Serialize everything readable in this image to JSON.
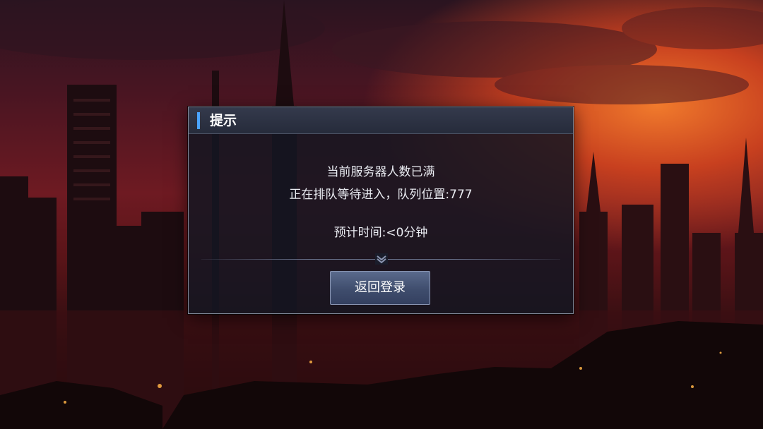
{
  "dialog": {
    "title": "提示",
    "message_line1": "当前服务器人数已满",
    "message_line2": "正在排队等待进入，队列位置:777",
    "message_line3": "预计时间:<0分钟",
    "return_button_label": "返回登录"
  },
  "colors": {
    "accent": "#4aa3ff",
    "sky_glow": "#f07a2c",
    "dialog_background": "#14162299"
  },
  "icons": {
    "divider": "chevron-down-icon"
  }
}
